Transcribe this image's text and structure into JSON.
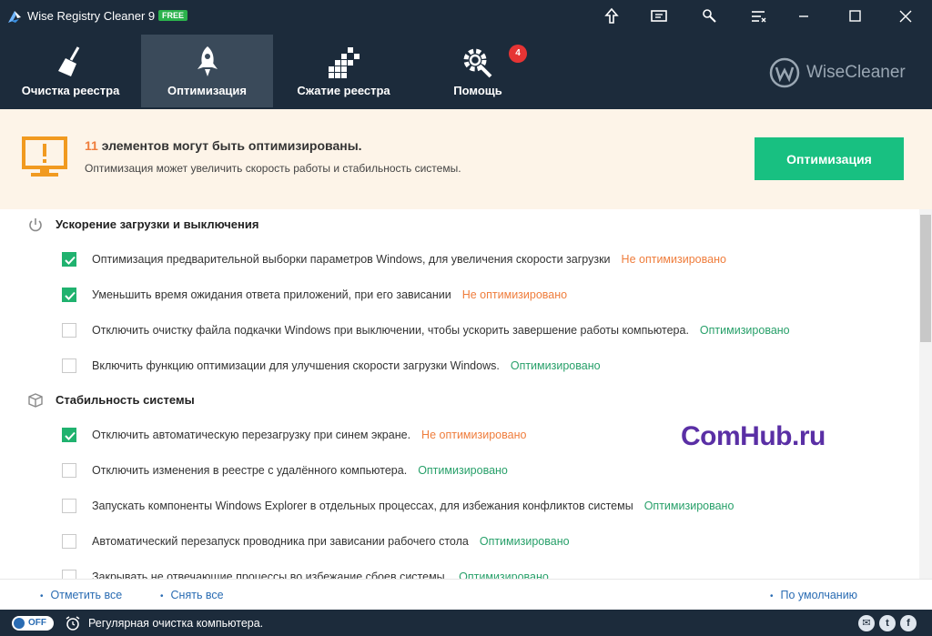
{
  "window": {
    "title": "Wise Registry Cleaner 9",
    "edition_badge": "FREE"
  },
  "nav": {
    "tabs": [
      {
        "label": "Очистка реестра",
        "icon": "broom-icon"
      },
      {
        "label": "Оптимизация",
        "icon": "rocket-icon",
        "active": true
      },
      {
        "label": "Сжатие реестра",
        "icon": "compress-blocks-icon"
      },
      {
        "label": "Помощь",
        "icon": "gear-wrench-icon"
      }
    ],
    "help_badge": "4",
    "brand": "WiseCleaner"
  },
  "banner": {
    "count": "11",
    "title_rest": " элементов могут быть оптимизированы.",
    "subtitle": "Оптимизация может увеличить скорость работы и стабильность системы.",
    "button_label": "Оптимизация"
  },
  "sections": [
    {
      "title": "Ускорение загрузки и выключения",
      "icon": "power-icon",
      "items": [
        {
          "text": "Оптимизация предварительной выборки параметров Windows, для увеличения скорости загрузки",
          "checked": true,
          "status": "Не оптимизировано"
        },
        {
          "text": "Уменьшить время ожидания ответа приложений, при его зависании",
          "checked": true,
          "status": "Не оптимизировано"
        },
        {
          "text": "Отключить очистку файла подкачки Windows при выключении, чтобы ускорить завершение работы компьютера.",
          "checked": false,
          "status": "Оптимизировано"
        },
        {
          "text": "Включить функцию оптимизации для улучшения скорости загрузки Windows.",
          "checked": false,
          "status": "Оптимизировано"
        }
      ]
    },
    {
      "title": "Стабильность системы",
      "icon": "cube-icon",
      "items": [
        {
          "text": "Отключить автоматическую перезагрузку при синем экране.",
          "checked": true,
          "status": "Не оптимизировано"
        },
        {
          "text": "Отключить изменения в реестре с удалённого компьютера.",
          "checked": false,
          "status": "Оптимизировано"
        },
        {
          "text": "Запускать компоненты Windows Explorer в отдельных процессах, для избежания конфликтов системы",
          "checked": false,
          "status": "Оптимизировано"
        },
        {
          "text": "Автоматический перезапуск проводника при зависании рабочего стола",
          "checked": false,
          "status": "Оптимизировано"
        },
        {
          "text": "Закрывать не отвечающие процессы во избежание сбоев системы.",
          "checked": false,
          "status": "Оптимизировано"
        }
      ]
    }
  ],
  "footer": {
    "select_all": "Отметить все",
    "deselect_all": "Снять все",
    "defaults": "По умолчанию"
  },
  "statusbar": {
    "toggle_label": "OFF",
    "text": "Регулярная очистка компьютера."
  },
  "watermark": "ComHub.ru",
  "colors": {
    "header_bg": "#1c2b3b",
    "active_tab_bg": "#3a4a5a",
    "accent_green": "#18c081",
    "status_not_optimized": "#ef7d3c",
    "status_optimized": "#28a06a",
    "banner_bg": "#fdf4e8"
  }
}
